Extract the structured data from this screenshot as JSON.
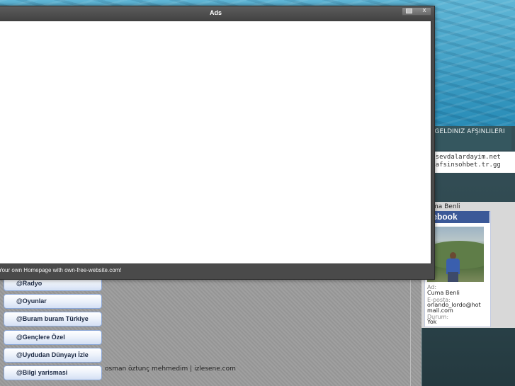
{
  "ads_window": {
    "title": "Ads",
    "footer_link": "Your own Homepage with own-free-website.com!",
    "close_label": "x"
  },
  "sidebar_right": {
    "welcome": "HOS GELDINIZ AFŞINLILERI",
    "links": [
      "www.sevdalardayim.net",
      "www.afsinsohbet.tr.gg"
    ],
    "profile_name": "Cuma Benli",
    "facebook_badge": {
      "brand": "facebook",
      "fields": [
        {
          "label": "Ad:",
          "value": "Cuma Benli"
        },
        {
          "label": "E-posta:",
          "value": "orlando_lordo@hotmail.com"
        },
        {
          "label": "Durum:",
          "value": "Yok"
        }
      ]
    }
  },
  "left_menu": {
    "items": [
      "@Radyo",
      "@Oyunlar",
      "@Buram buram Türkiye",
      "@Gençlere Özel",
      "@Uydudan Dünyayı İzle",
      "@Bilgi yarismasi"
    ]
  },
  "main": {
    "caption": "osman öztunç mehmedim | izlesene.com"
  },
  "colors": {
    "menu_border": "#8aa6d6",
    "facebook_blue": "#3b5998",
    "modal_dark": "#4a4a4a"
  }
}
